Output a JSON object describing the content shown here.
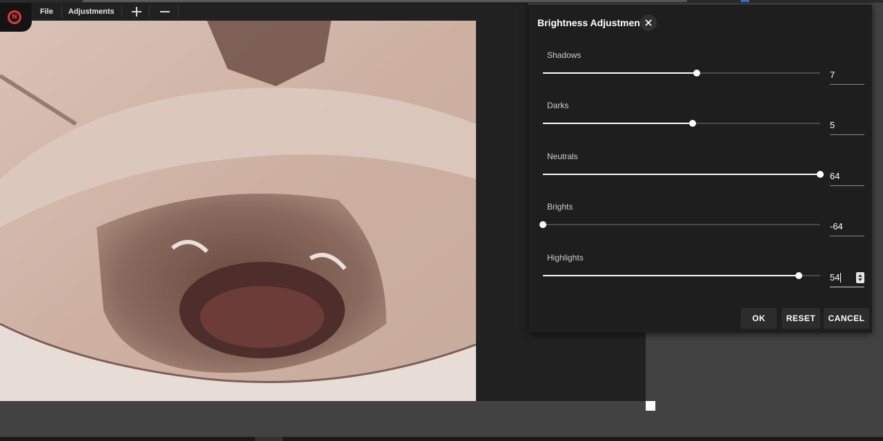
{
  "toolbar": {
    "file_label": "File",
    "adjustments_label": "Adjustments",
    "zoom_in_icon": "plus-icon",
    "zoom_out_icon": "minus-icon",
    "logo_letter": "N"
  },
  "dialog": {
    "title": "Brightness Adjustment",
    "sliders": [
      {
        "label": "Shadows",
        "value": "7",
        "position": 0.555
      },
      {
        "label": "Darks",
        "value": "5",
        "position": 0.54
      },
      {
        "label": "Neutrals",
        "value": "64",
        "position": 1.0
      },
      {
        "label": "Brights",
        "value": "-64",
        "position": 0.0
      },
      {
        "label": "Highlights",
        "value": "54",
        "position": 0.922
      }
    ],
    "buttons": {
      "ok": "OK",
      "reset": "RESET",
      "cancel": "CANCEL"
    }
  },
  "colors": {
    "accent": "#e53935",
    "panel": "#1e1e1e",
    "workspace": "#424242"
  }
}
